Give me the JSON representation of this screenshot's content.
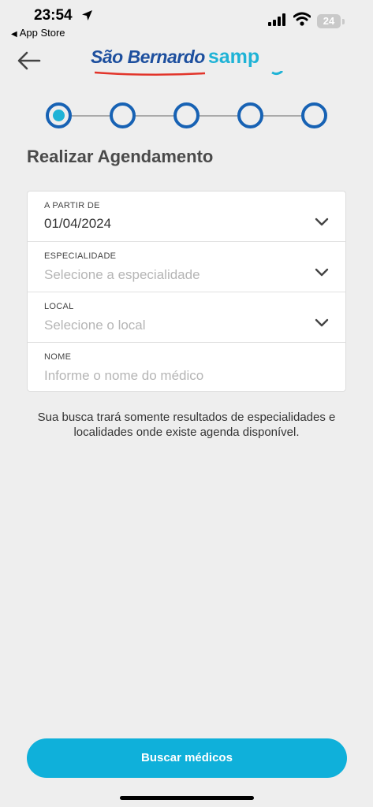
{
  "status_bar": {
    "time": "23:54",
    "back_app": "App Store",
    "battery": "24"
  },
  "header": {
    "logo_text": "São Bernardo",
    "logo_accent": "samp"
  },
  "stepper": {
    "total_steps": 5,
    "current_step": 1
  },
  "page": {
    "title": "Realizar Agendamento"
  },
  "form": {
    "date": {
      "label": "A PARTIR DE",
      "value": "01/04/2024"
    },
    "specialty": {
      "label": "ESPECIALIDADE",
      "placeholder": "Selecione a especialidade"
    },
    "location": {
      "label": "LOCAL",
      "placeholder": "Selecione o local"
    },
    "doctor_name": {
      "label": "NOME",
      "placeholder": "Informe o nome do médico"
    }
  },
  "info": {
    "text": "Sua busca trará somente resultados de especialidades e localidades onde existe agenda disponível."
  },
  "actions": {
    "search_label": "Buscar médicos"
  },
  "colors": {
    "primary": "#0fb0da",
    "step_border": "#1762b4",
    "brand_blue": "#1d4f9e",
    "brand_cyan": "#1fb3d6",
    "background": "#eeeeee"
  }
}
